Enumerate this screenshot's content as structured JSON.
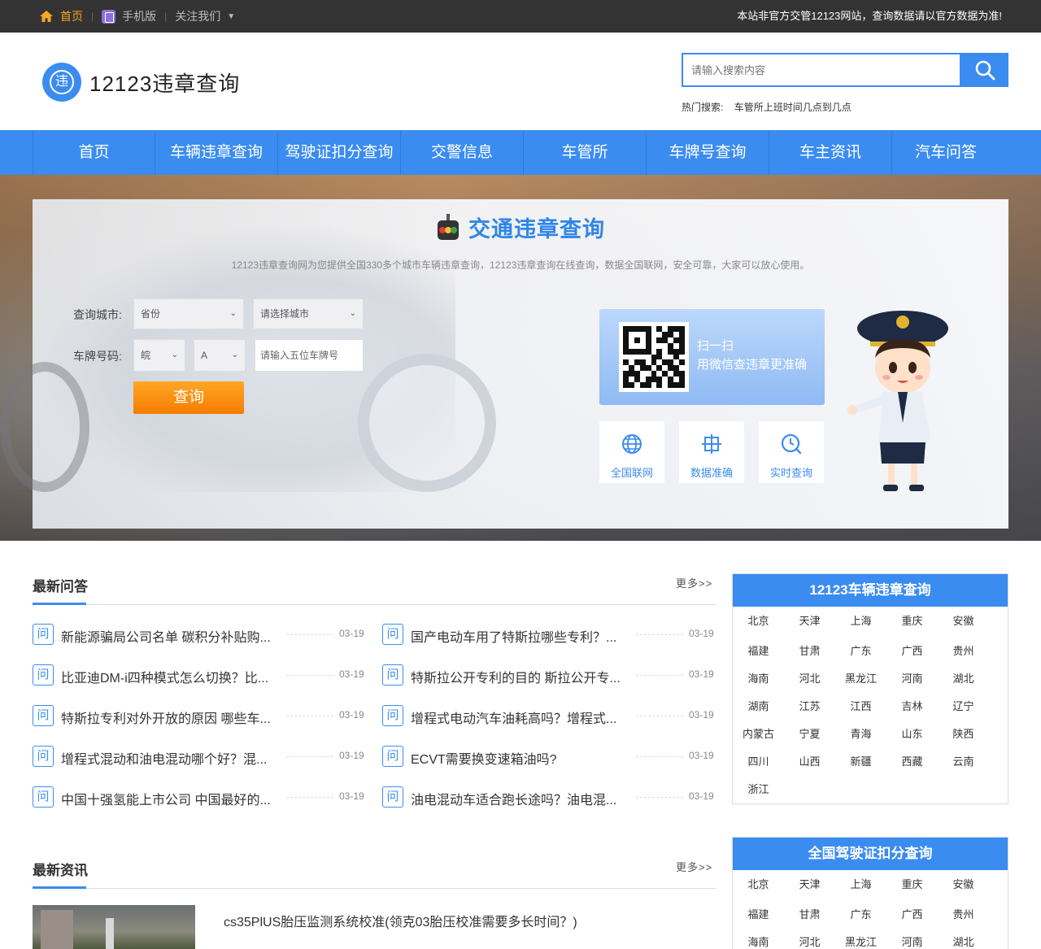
{
  "topbar": {
    "home": "首页",
    "mobile": "手机版",
    "follow": "关注我们",
    "notice": "本站非官方交管12123网站，查询数据请以官方数据为准!"
  },
  "header": {
    "logo_glyph": "违",
    "logo_text": "12123违章查询",
    "search_placeholder": "请输入搜索内容",
    "hot_label": "热门搜索:",
    "hot_item": "车管所上班时间几点到几点"
  },
  "nav": [
    "首页",
    "车辆违章查询",
    "驾驶证扣分查询",
    "交警信息",
    "车管所",
    "车牌号查询",
    "车主资讯",
    "汽车问答"
  ],
  "query_panel": {
    "title": "交通违章查询",
    "desc": "12123违章查询网为您提供全国330多个城市车辆违章查询，12123违章查询在线查询，数据全国联网，安全可靠，大家可以放心使用。",
    "city_label": "查询城市:",
    "province_select": "省份",
    "city_select": "请选择城市",
    "plate_label": "车牌号码:",
    "plate_prefix": "皖",
    "plate_letter": "A",
    "plate_placeholder": "请输入五位车牌号",
    "submit": "查询",
    "qr_line1": "扫一扫",
    "qr_line2": "用微信查违章更准确",
    "features": [
      {
        "label": "全国联网",
        "icon": "globe-icon"
      },
      {
        "label": "数据准确",
        "icon": "crosshair-icon"
      },
      {
        "label": "实时查询",
        "icon": "clock-search-icon"
      }
    ]
  },
  "qa": {
    "title": "最新问答",
    "more": "更多>>",
    "icon_glyph": "问",
    "items": [
      {
        "text": "新能源骗局公司名单 碳积分补贴购...",
        "date": "03-19"
      },
      {
        "text": "国产电动车用了特斯拉哪些专利？...",
        "date": "03-19"
      },
      {
        "text": "比亚迪DM-i四种模式怎么切换？比...",
        "date": "03-19"
      },
      {
        "text": "特斯拉公开专利的目的 斯拉公开专...",
        "date": "03-19"
      },
      {
        "text": "特斯拉专利对外开放的原因 哪些车...",
        "date": "03-19"
      },
      {
        "text": "增程式电动汽车油耗高吗？增程式...",
        "date": "03-19"
      },
      {
        "text": "增程式混动和油电混动哪个好？混...",
        "date": "03-19"
      },
      {
        "text": "ECVT需要换变速箱油吗?",
        "date": "03-19"
      },
      {
        "text": "中国十强氢能上市公司 中国最好的...",
        "date": "03-19"
      },
      {
        "text": "油电混动车适合跑长途吗？油电混...",
        "date": "03-19"
      }
    ]
  },
  "news": {
    "title": "最新资讯",
    "more": "更多>>",
    "first_title": "cs35PlUS胎压监测系统校准(领克03胎压校准需要多长时间？)"
  },
  "sidebar": {
    "violation": {
      "title": "12123车辆违章查询",
      "cities": [
        "北京",
        "天津",
        "上海",
        "重庆",
        "安徽",
        "福建",
        "甘肃",
        "广东",
        "广西",
        "贵州",
        "海南",
        "河北",
        "黑龙江",
        "河南",
        "湖北",
        "湖南",
        "江苏",
        "江西",
        "吉林",
        "辽宁",
        "内蒙古",
        "宁夏",
        "青海",
        "山东",
        "陕西",
        "四川",
        "山西",
        "新疆",
        "西藏",
        "云南",
        "浙江"
      ]
    },
    "license": {
      "title": "全国驾驶证扣分查询",
      "cities": [
        "北京",
        "天津",
        "上海",
        "重庆",
        "安徽",
        "福建",
        "甘肃",
        "广东",
        "广西",
        "贵州",
        "海南",
        "河北",
        "黑龙江",
        "河南",
        "湖北"
      ]
    }
  },
  "colors": {
    "primary": "#3b8cf0",
    "accent": "#f5a623",
    "button": "#f57c00",
    "topbar": "#333333"
  }
}
